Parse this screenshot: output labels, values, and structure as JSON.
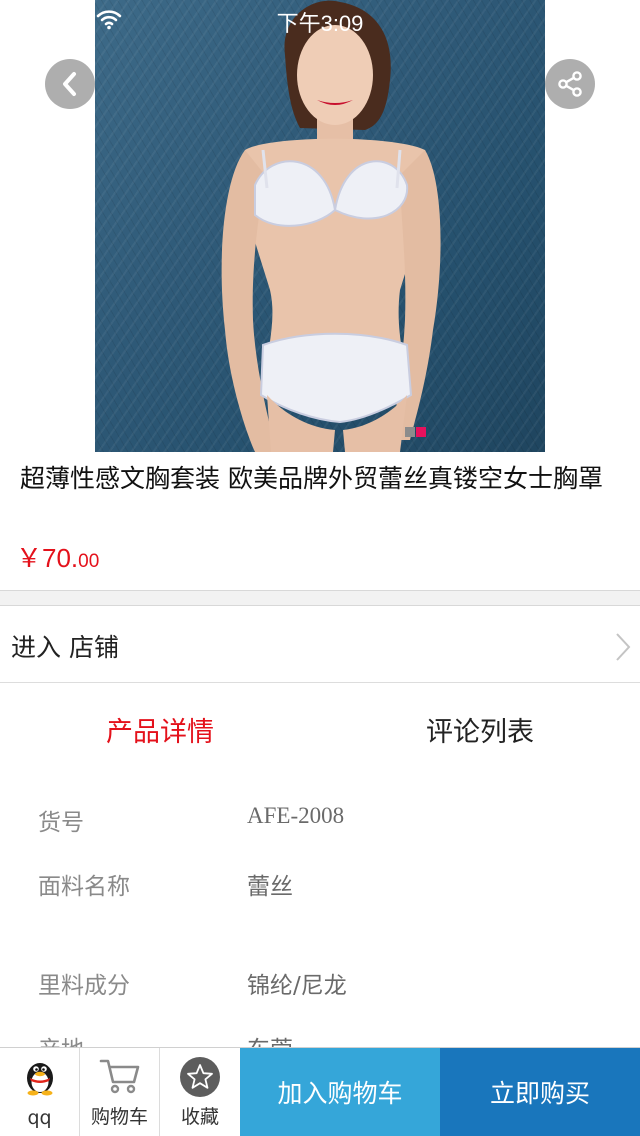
{
  "status_bar": {
    "time": "下午3:09"
  },
  "product": {
    "title": "超薄性感文胸套装 欧美品牌外贸蕾丝真镂空女士胸罩",
    "price_major": "￥70.",
    "price_minor": "00"
  },
  "carousel": {
    "dot_colors": [
      "#8c8c8c",
      "#e8115d"
    ]
  },
  "shop": {
    "label": "进入 店铺"
  },
  "tabs": [
    {
      "label": "产品详情",
      "active": true
    },
    {
      "label": "评论列表",
      "active": false
    }
  ],
  "specs": [
    {
      "key": "货号",
      "value": "AFE-2008"
    },
    {
      "key": "面料名称",
      "value": "蕾丝"
    },
    {
      "key": "里料成分",
      "value": "锦纶/尼龙"
    },
    {
      "key": "产地",
      "value": "东莞"
    }
  ],
  "bottom_bar": {
    "qq_label": "qq",
    "cart_label": "购物车",
    "favorite_label": "收藏",
    "add_to_cart": "加入购物车",
    "buy_now": "立即购买"
  },
  "colors": {
    "accent_red": "#e4111b",
    "add_button": "#35a6d9",
    "buy_button": "#1976bc"
  }
}
